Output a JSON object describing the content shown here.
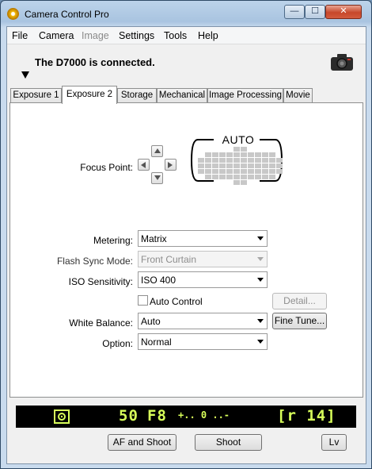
{
  "window": {
    "title": "Camera Control Pro",
    "minimize_label": "—",
    "maximize_label": "☐",
    "close_label": "✕"
  },
  "menu": [
    "File",
    "Camera",
    "Image",
    "Settings",
    "Tools",
    "Help"
  ],
  "status": {
    "message": "The D7000 is connected."
  },
  "tabs": [
    "Exposure 1",
    "Exposure 2",
    "Storage",
    "Mechanical",
    "Image Processing",
    "Movie"
  ],
  "active_tab": "Exposure 2",
  "focus": {
    "label": "Focus Point:",
    "mode": "AUTO"
  },
  "fields": {
    "metering": {
      "label": "Metering:",
      "value": "Matrix"
    },
    "flash_sync": {
      "label": "Flash Sync Mode:",
      "value": "Front Curtain"
    },
    "iso": {
      "label": "ISO Sensitivity:",
      "value": "ISO 400"
    },
    "auto_control": {
      "label": "Auto Control",
      "checked": false
    },
    "white_balance": {
      "label": "White Balance:",
      "value": "Auto"
    },
    "option": {
      "label": "Option:",
      "value": "Normal"
    }
  },
  "buttons": {
    "detail": "Detail...",
    "fine_tune": "Fine Tune...",
    "af_and_shoot": "AF and Shoot",
    "shoot": "Shoot",
    "lv": "Lv"
  },
  "lcd": {
    "shutter": "50",
    "aperture": "F8",
    "exposure_scale": "+.. 0 ..-",
    "remaining": "[r 14]",
    "color": "#d8ff5a"
  }
}
